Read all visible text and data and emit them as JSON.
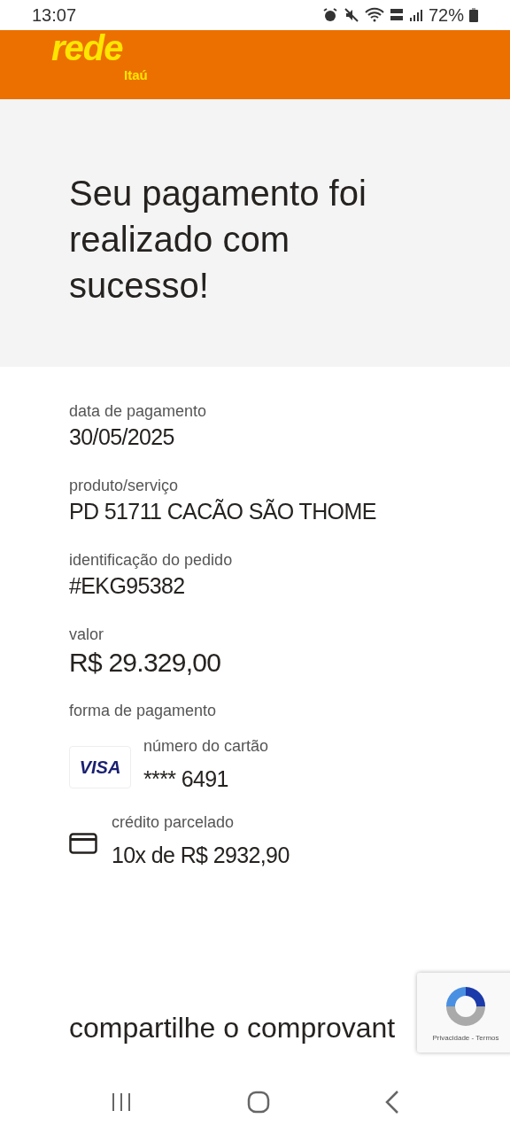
{
  "status_bar": {
    "time": "13:07",
    "battery": "72%"
  },
  "header": {
    "logo": "rede",
    "logo_sub": "Itaú"
  },
  "title": "Seu pagamento foi realizado com sucesso!",
  "fields": [
    {
      "label": "data de pagamento",
      "value": "30/05/2025"
    },
    {
      "label": "produto/serviço",
      "value": "PD 51711 CACÃO SÃO THOME"
    },
    {
      "label": "identificação do pedido",
      "value": "#EKG95382"
    },
    {
      "label": "valor",
      "value": "R$ 29.329,00",
      "kind": "amount"
    }
  ],
  "payment": {
    "label": "forma de pagamento",
    "items": [
      {
        "kind": "card_brand",
        "brand": "VISA",
        "label": "número do cartão",
        "value": "**** 6491"
      },
      {
        "kind": "card_icon",
        "label": "crédito parcelado",
        "value": "10x de R$ 2932,90"
      }
    ]
  },
  "share_heading": "compartilhe o comprovant",
  "recaptcha": {
    "links": "Privacidade - Termos"
  }
}
